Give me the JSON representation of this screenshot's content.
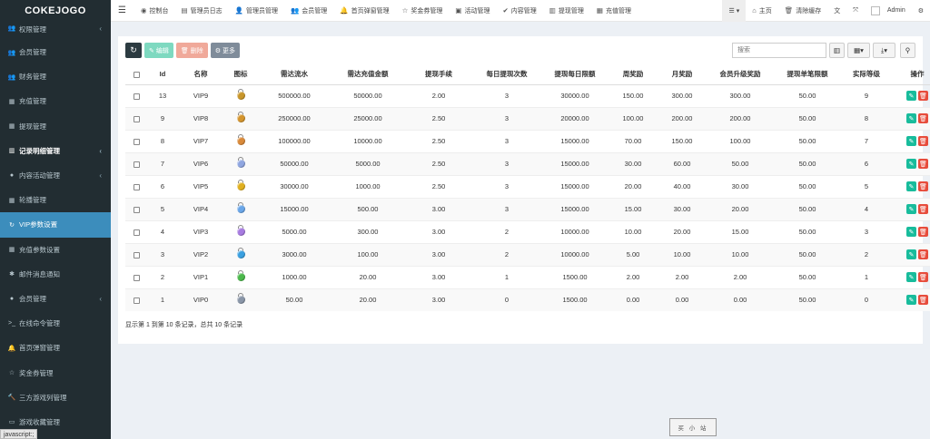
{
  "brand": "COKEJOGO",
  "status_text": "javascript:;",
  "sidebar": {
    "items": [
      {
        "label": "权限管理",
        "icon": "user-group-icon",
        "glyph": "👥",
        "caret": "‹",
        "style": "first"
      },
      {
        "label": "会员管理",
        "icon": "user-icon",
        "glyph": "👥",
        "caret": "",
        "style": ""
      },
      {
        "label": "财务管理",
        "icon": "user-icon",
        "glyph": "👥",
        "caret": "",
        "style": ""
      },
      {
        "label": "充值管理",
        "icon": "table-icon",
        "glyph": "▦",
        "caret": "",
        "style": ""
      },
      {
        "label": "提现管理",
        "icon": "table-icon",
        "glyph": "▦",
        "caret": "",
        "style": ""
      },
      {
        "label": "记录明细管理",
        "icon": "chart-icon",
        "glyph": "▥",
        "caret": "‹",
        "style": "bold"
      },
      {
        "label": "内容活动管理",
        "icon": "circle-icon",
        "glyph": "●",
        "caret": "‹",
        "style": ""
      },
      {
        "label": "轮播管理",
        "icon": "grid-icon",
        "glyph": "▦",
        "caret": "",
        "style": ""
      },
      {
        "label": "VIP参数设置",
        "icon": "refresh-icon",
        "glyph": "↻",
        "caret": "",
        "style": "active"
      },
      {
        "label": "充值参数设置",
        "icon": "grid-icon",
        "glyph": "▦",
        "caret": "",
        "style": ""
      },
      {
        "label": "邮件消息通知",
        "icon": "gear-icon",
        "glyph": "✱",
        "caret": "",
        "style": ""
      },
      {
        "label": "会员管理",
        "icon": "circle-icon",
        "glyph": "●",
        "caret": "‹",
        "style": ""
      },
      {
        "label": "在线命令管理",
        "icon": "terminal-icon",
        "glyph": ">_",
        "caret": "",
        "style": ""
      },
      {
        "label": "首页弹窗管理",
        "icon": "bell-icon",
        "glyph": "🔔",
        "caret": "",
        "style": ""
      },
      {
        "label": "奖金券管理",
        "icon": "star-icon",
        "glyph": "☆",
        "caret": "",
        "style": ""
      },
      {
        "label": "三方游戏列管理",
        "icon": "gavel-icon",
        "glyph": "🔨",
        "caret": "",
        "style": ""
      },
      {
        "label": "游戏收藏管理",
        "icon": "folder-icon",
        "glyph": "▭",
        "caret": "",
        "style": ""
      }
    ]
  },
  "topbar": {
    "tabs": [
      {
        "label": "控制台",
        "icon": "dashboard-icon",
        "glyph": "◉"
      },
      {
        "label": "管理员日志",
        "icon": "list-icon",
        "glyph": "▤"
      },
      {
        "label": "管理员管理",
        "icon": "user-icon",
        "glyph": "👤"
      },
      {
        "label": "会员管理",
        "icon": "users-icon",
        "glyph": "👥"
      },
      {
        "label": "首页弹窗管理",
        "icon": "bell-icon",
        "glyph": "🔔"
      },
      {
        "label": "奖金券管理",
        "icon": "star-icon",
        "glyph": "☆"
      },
      {
        "label": "活动管理",
        "icon": "calendar-icon",
        "glyph": "▣"
      },
      {
        "label": "内容管理",
        "icon": "check-circle-icon",
        "glyph": "✔"
      },
      {
        "label": "提现管理",
        "icon": "chart-icon",
        "glyph": "▥"
      },
      {
        "label": "充值管理",
        "icon": "table-icon",
        "glyph": "▦"
      }
    ],
    "home": "主页",
    "clear_cache": "清除缓存",
    "admin": "Admin"
  },
  "toolbar": {
    "refresh": "↻",
    "edit": "编辑",
    "delete": "删除",
    "more": "更多"
  },
  "search": {
    "placeholder": "搜索"
  },
  "table": {
    "headers": [
      "Id",
      "名称",
      "图标",
      "需达流水",
      "需达充值金额",
      "提现手续",
      "每日提现次数",
      "提现每日限额",
      "周奖励",
      "月奖励",
      "会员升级奖励",
      "提现单笔限额",
      "实际等级",
      "操作"
    ],
    "rows": [
      {
        "id": "13",
        "name": "VIP9",
        "medal": "#c8962a",
        "flow": "500000.00",
        "recharge": "50000.00",
        "fee": "2.00",
        "times": "3",
        "daily": "30000.00",
        "week": "150.00",
        "month": "300.00",
        "upgrade": "300.00",
        "single": "50.00",
        "level": "9"
      },
      {
        "id": "9",
        "name": "VIP8",
        "medal": "#d4952e",
        "flow": "250000.00",
        "recharge": "25000.00",
        "fee": "2.50",
        "times": "3",
        "daily": "20000.00",
        "week": "100.00",
        "month": "200.00",
        "upgrade": "200.00",
        "single": "50.00",
        "level": "8"
      },
      {
        "id": "8",
        "name": "VIP7",
        "medal": "#d98a3a",
        "flow": "100000.00",
        "recharge": "10000.00",
        "fee": "2.50",
        "times": "3",
        "daily": "15000.00",
        "week": "70.00",
        "month": "150.00",
        "upgrade": "100.00",
        "single": "50.00",
        "level": "7"
      },
      {
        "id": "7",
        "name": "VIP6",
        "medal": "#8fa6e0",
        "flow": "50000.00",
        "recharge": "5000.00",
        "fee": "2.50",
        "times": "3",
        "daily": "15000.00",
        "week": "30.00",
        "month": "60.00",
        "upgrade": "50.00",
        "single": "50.00",
        "level": "6"
      },
      {
        "id": "6",
        "name": "VIP5",
        "medal": "#e0b020",
        "flow": "30000.00",
        "recharge": "1000.00",
        "fee": "2.50",
        "times": "3",
        "daily": "15000.00",
        "week": "20.00",
        "month": "40.00",
        "upgrade": "30.00",
        "single": "50.00",
        "level": "5"
      },
      {
        "id": "5",
        "name": "VIP4",
        "medal": "#6aa6e8",
        "flow": "15000.00",
        "recharge": "500.00",
        "fee": "3.00",
        "times": "3",
        "daily": "15000.00",
        "week": "15.00",
        "month": "30.00",
        "upgrade": "20.00",
        "single": "50.00",
        "level": "4"
      },
      {
        "id": "4",
        "name": "VIP3",
        "medal": "#a77be0",
        "flow": "5000.00",
        "recharge": "300.00",
        "fee": "3.00",
        "times": "2",
        "daily": "10000.00",
        "week": "10.00",
        "month": "20.00",
        "upgrade": "15.00",
        "single": "50.00",
        "level": "3"
      },
      {
        "id": "3",
        "name": "VIP2",
        "medal": "#3aa0e0",
        "flow": "3000.00",
        "recharge": "100.00",
        "fee": "3.00",
        "times": "2",
        "daily": "10000.00",
        "week": "5.00",
        "month": "10.00",
        "upgrade": "10.00",
        "single": "50.00",
        "level": "2"
      },
      {
        "id": "2",
        "name": "VIP1",
        "medal": "#4cb84c",
        "flow": "1000.00",
        "recharge": "20.00",
        "fee": "3.00",
        "times": "1",
        "daily": "1500.00",
        "week": "2.00",
        "month": "2.00",
        "upgrade": "2.00",
        "single": "50.00",
        "level": "1"
      },
      {
        "id": "1",
        "name": "VIP0",
        "medal": "#8a96a8",
        "flow": "50.00",
        "recharge": "20.00",
        "fee": "3.00",
        "times": "0",
        "daily": "1500.00",
        "week": "0.00",
        "month": "0.00",
        "upgrade": "0.00",
        "single": "50.00",
        "level": "0"
      }
    ]
  },
  "pager_info": "显示第 1 到第 10 条记录，总共 10 条记录",
  "watermark": "买 小 站"
}
